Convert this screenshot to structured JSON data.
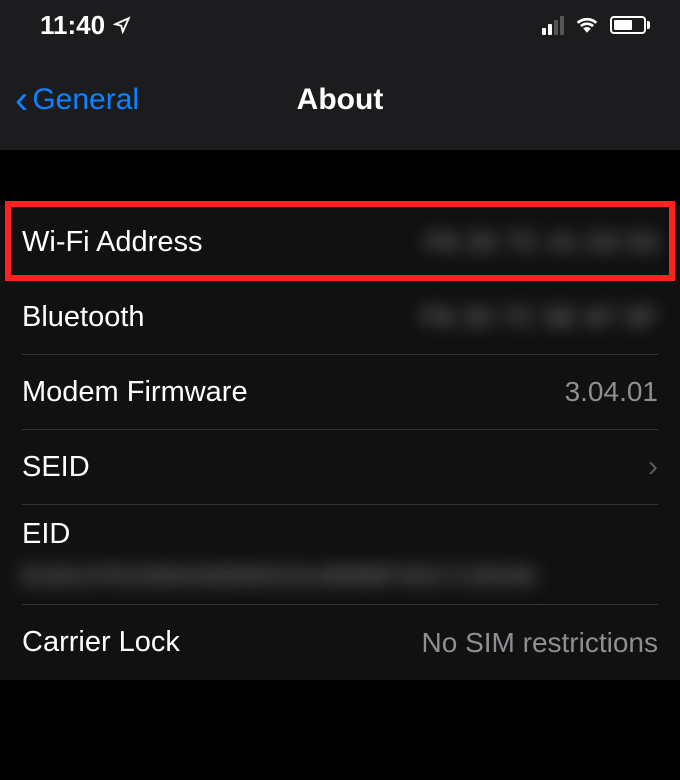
{
  "statusBar": {
    "time": "11:40"
  },
  "nav": {
    "backLabel": "General",
    "title": "About"
  },
  "rows": {
    "wifiAddress": {
      "label": "Wi-Fi Address",
      "value": "F8 20 7C 41 03 03"
    },
    "bluetooth": {
      "label": "Bluetooth",
      "value": "F8 20 7C 5E 87 5F"
    },
    "modemFirmware": {
      "label": "Modem Firmware",
      "value": "3.04.01"
    },
    "seid": {
      "label": "SEID"
    },
    "eid": {
      "label": "EID",
      "value": "B1B41FE5308440859032A4888BFN527128346"
    },
    "carrierLock": {
      "label": "Carrier Lock",
      "value": "No SIM restrictions"
    }
  }
}
